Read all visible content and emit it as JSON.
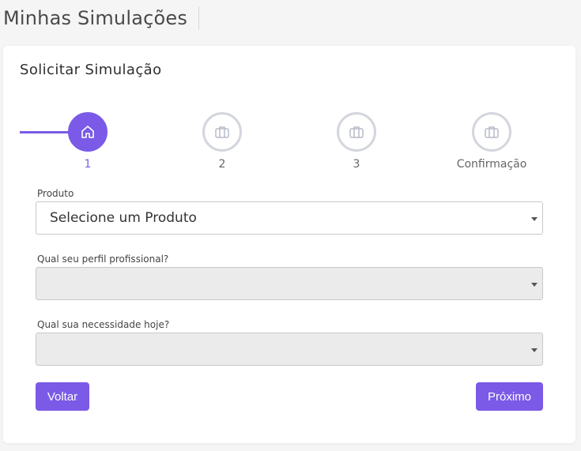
{
  "header": {
    "title": "Minhas Simulações"
  },
  "card": {
    "title": "Solicitar Simulação"
  },
  "stepper": {
    "accent_color": "#7a5ae6",
    "steps": [
      {
        "label": "1",
        "icon": "home-icon",
        "active": true
      },
      {
        "label": "2",
        "icon": "briefcase-icon",
        "active": false
      },
      {
        "label": "3",
        "icon": "briefcase-icon",
        "active": false
      },
      {
        "label": "Confirmação",
        "icon": "briefcase-icon",
        "active": false
      }
    ]
  },
  "form": {
    "produto": {
      "label": "Produto",
      "value": "Selecione um Produto"
    },
    "perfil": {
      "label": "Qual seu perfil profissional?",
      "value": ""
    },
    "necessidade": {
      "label": "Qual sua necessidade hoje?",
      "value": ""
    }
  },
  "actions": {
    "back_label": "Voltar",
    "next_label": "Próximo"
  }
}
